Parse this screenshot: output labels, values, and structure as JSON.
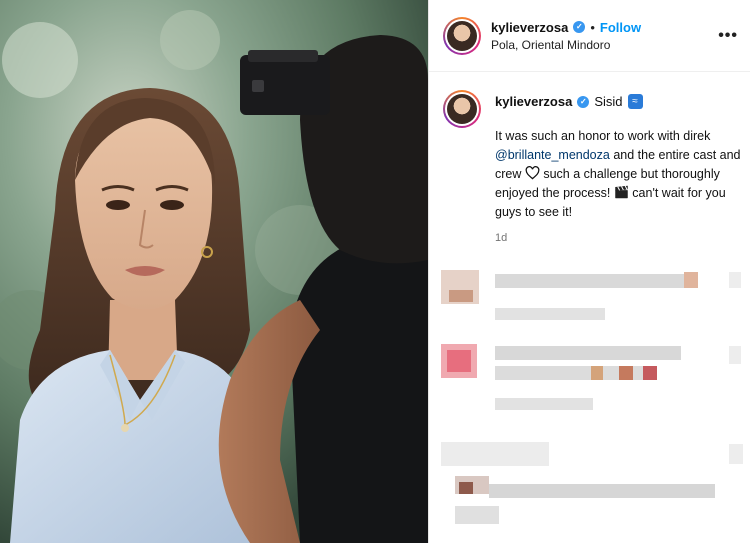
{
  "header": {
    "username": "kylieverzosa",
    "separator": "•",
    "follow_label": "Follow",
    "location": "Pola, Oriental Mindoro",
    "more_label": "•••"
  },
  "caption": {
    "username": "kylieverzosa",
    "title": "Sisid",
    "text_before_mention": "It was such an honor to work with direk ",
    "mention": "@brillante_mendoza",
    "text_after_mention": " and the entire cast and crew ",
    "text_after_heart": " such a challenge but thoroughly enjoyed the process! ",
    "text_end": " can't wait for you guys to see it!",
    "timestamp": "1d"
  },
  "icons": {
    "verified": "verified-badge-icon",
    "wave": "wave-emoji-icon",
    "heart": "heart-outline-icon",
    "clapper": "clapper-board-icon",
    "more": "more-options-icon"
  },
  "colors": {
    "follow": "#0095f6",
    "verified": "#3897f0",
    "mention": "#00376b",
    "timestamp": "#737373"
  }
}
